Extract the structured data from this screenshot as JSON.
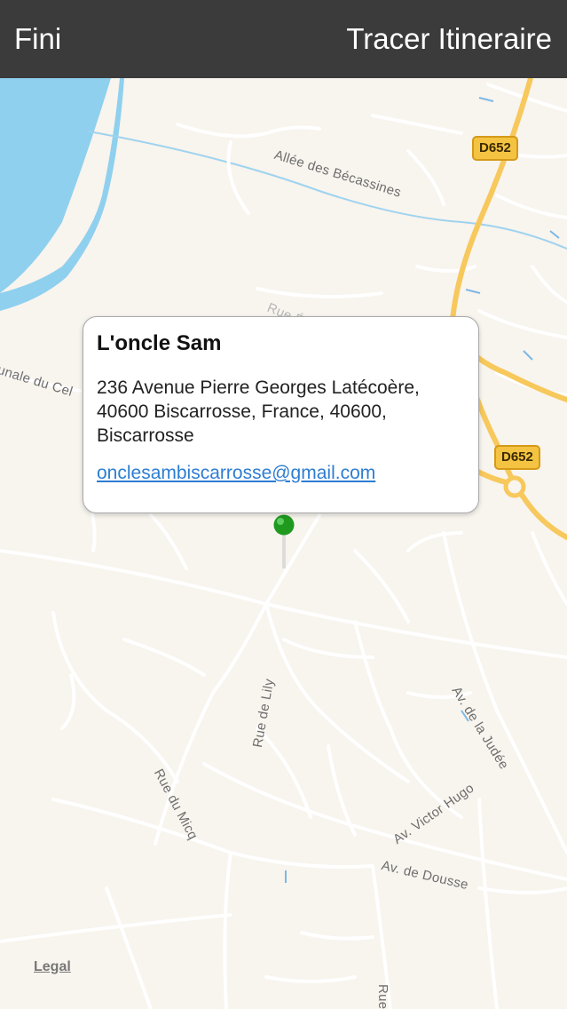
{
  "navbar": {
    "done_label": "Fini",
    "directions_label": "Tracer Itineraire"
  },
  "place": {
    "name": "L'oncle Sam",
    "address_lines": [
      "236 Avenue Pierre Georges Latécoère,",
      "40600 Biscarrosse, France, 40600,",
      "Biscarrosse"
    ],
    "email": "onclesambiscarrosse@gmail.com"
  },
  "map": {
    "road_labels": {
      "allee_becassines": "Allée des Bécassines",
      "rue_edouard_branly": "Rue Édouard Branly",
      "rue_nale_du_cel": "unale du Cel",
      "rue_de_lily": "Rue de Lily",
      "rue_du_micq": "Rue du Micq",
      "av_de_la_judee": "Av. de la Judée",
      "av_victor_hugo": "Av. Victor Hugo",
      "av_de_dousse": "Av. de Dousse",
      "rue_bottom": "Rue"
    },
    "shields": [
      "D652",
      "D652"
    ],
    "legal_label": "Legal",
    "colors": {
      "water": "#8fd0ee",
      "land": "#f8f4ee",
      "road": "#ffffff",
      "major_road": "#f7c85b",
      "pin": "#1f9a1f"
    }
  }
}
